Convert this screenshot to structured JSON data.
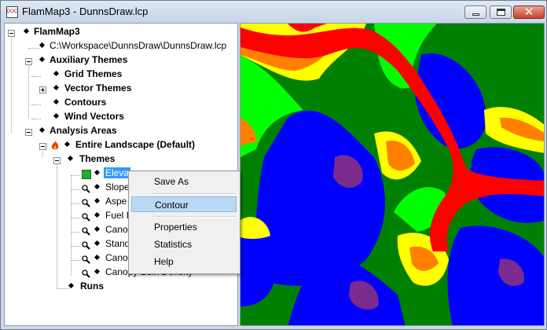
{
  "window": {
    "title": "FlamMap3 - DunnsDraw.lcp",
    "app_icon": "doc-icon"
  },
  "tree": {
    "root": "FlamMap3",
    "landscape_file": "C:\\Workspace\\DunnsDraw\\DunnsDraw.lcp",
    "auxiliary_themes": "Auxiliary Themes",
    "grid_themes": "Grid Themes",
    "vector_themes": "Vector Themes",
    "contours": "Contours",
    "wind_vectors": "Wind Vectors",
    "analysis_areas": "Analysis Areas",
    "entire_landscape": "Entire Landscape (Default)",
    "themes": "Themes",
    "theme_items": [
      "Elevation",
      "Slope",
      "Aspect",
      "Fuel Model",
      "Canopy Cover",
      "Stand Height",
      "Canopy Base Height",
      "Canopy Bulk Density"
    ],
    "theme_items_visible": [
      "Eleva",
      "Slope",
      "Aspe",
      "Fuel I",
      "Cano",
      "Stand",
      "Cano",
      "Canopy Bulk Density"
    ],
    "runs": "Runs"
  },
  "context_menu": {
    "items": [
      "Save As",
      "Contour",
      "Properties",
      "Statistics",
      "Help"
    ],
    "highlighted": "Contour"
  },
  "map": {
    "colors": {
      "low": "#0000ff",
      "mid_low": "#008000",
      "mid": "#00ff00",
      "mid_high": "#ffff00",
      "high": "#ff8000",
      "ridge": "#ff0000",
      "peak": "#7b2a8e"
    }
  }
}
